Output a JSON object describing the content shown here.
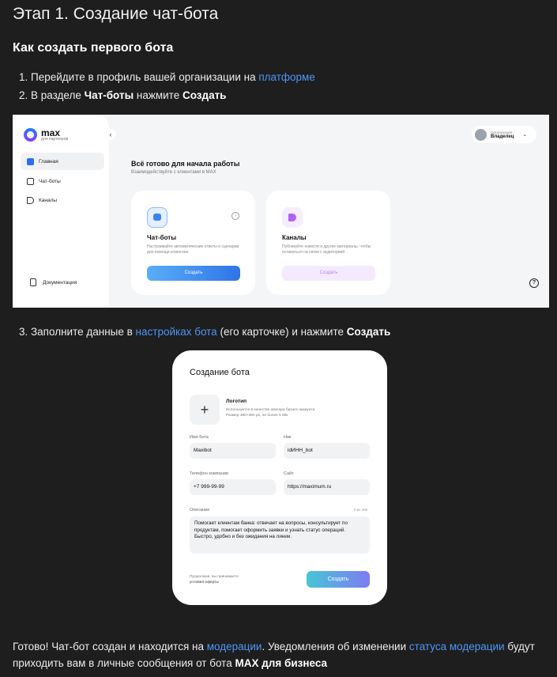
{
  "heading": "Этап 1. Создание чат-бота",
  "subheading": "Как создать первого бота",
  "steps": {
    "s1_pre": "1. Перейдите в профиль вашей организации на ",
    "s1_link": "платформе",
    "s2_pre": "2. В разделе ",
    "s2_bold1": "Чат-боты",
    "s2_mid": " нажмите ",
    "s2_bold2": "Создать",
    "s3_pre": "3. Заполните данные в ",
    "s3_link": "настройках бота",
    "s3_mid": " (его карточке) и нажмите ",
    "s3_bold": "Создать"
  },
  "shot1": {
    "logo_name": "max",
    "logo_sub": "для партнеров",
    "nav": [
      "Главная",
      "Чат-боты",
      "Каналы"
    ],
    "docs": "Документация",
    "org_label": "Организация",
    "org_value": "Владелец",
    "title": "Всё готово для начала работы",
    "subtitle": "Взаимодействуйте с клиентами в MAX",
    "card_bots": {
      "title": "Чат-боты",
      "desc": "Настраивайте автоматические ответы и сценарии для помощи клиентам",
      "button": "Создать"
    },
    "card_channels": {
      "title": "Каналы",
      "desc": "Публикуйте новости и другие материалы, чтобы оставаться на связи с аудиторией",
      "button": "Создать"
    }
  },
  "shot2": {
    "title": "Создание бота",
    "logo_title": "Логотип",
    "logo_hint1": "Используется в качестве аватара бизнес-аккаунта",
    "logo_hint2": "Размер 380×380 px, не более 5 МБ",
    "name_label": "Имя бота",
    "name_value": "Maxibot",
    "nick_label": "Ник",
    "nick_value": "idИНН_bot",
    "phone_label": "Телефон компании",
    "phone_value": "+7 999-99-99",
    "site_label": "Сайт",
    "site_value": "https://maximum.ru",
    "desc_label": "Описание",
    "desc_counter": "0 из 200",
    "desc_value": "Помогает клиентам банка: отвечает на вопросы, консультирует по продуктам, помогает оформить заявки и узнать статус операций. Быстро, удобно и без ожидания на линии.",
    "offer_line1": "Продолжая, вы принимаете",
    "offer_line2": "условия оферты",
    "create_button": "Создать"
  },
  "final": {
    "p1": "Готово! Чат-бот создан и находится на ",
    "link1": "модерации",
    "p2": ". Уведомления об изменении ",
    "link2": "статуса модерации",
    "p3": " будут приходить вам в личные сообщения от бота ",
    "bold": "MAX для бизнеса"
  },
  "colors": {
    "background": "#1e1e1e",
    "link": "#4e95f5",
    "accent_blue": "#3a84f0",
    "accent_purple": "#b061f0"
  }
}
